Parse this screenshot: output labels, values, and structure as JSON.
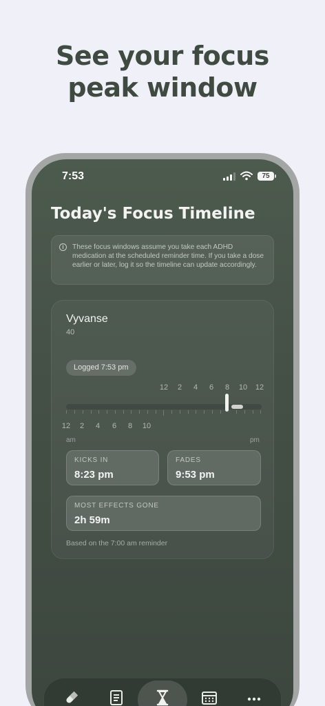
{
  "promo": {
    "headline_line1": "See your focus",
    "headline_line2": "peak window"
  },
  "status_bar": {
    "time": "7:53",
    "battery": "75"
  },
  "screen": {
    "title": "Today's Focus Timeline",
    "info_note": "These focus windows assume you take each ADHD medication at the scheduled reminder time. If you take a dose earlier or later, log it so the timeline can update accordingly.",
    "info_icon": "info-circle-icon"
  },
  "medication_card": {
    "name": "Vyvanse",
    "dose": "40",
    "logged_chip": "Logged 7:53 pm",
    "upper_ticks": [
      "12",
      "2",
      "4",
      "6",
      "8",
      "10",
      "12"
    ],
    "lower_ticks": [
      "12",
      "2",
      "4",
      "6",
      "8",
      "10"
    ],
    "am_label": "am",
    "pm_label": "pm",
    "kicks_in_label": "KICKS IN",
    "kicks_in_value": "8:23 pm",
    "fades_label": "FADES",
    "fades_value": "9:53 pm",
    "effects_gone_label": "MOST EFFECTS GONE",
    "effects_gone_value": "2h 59m",
    "footnote": "Based on the 7:00 am reminder"
  },
  "tab_bar": {
    "tabs": [
      {
        "icon": "pill-icon",
        "active": false
      },
      {
        "icon": "notes-icon",
        "active": false
      },
      {
        "icon": "hourglass-icon",
        "active": true
      },
      {
        "icon": "calendar-icon",
        "active": false
      },
      {
        "icon": "more-icon",
        "active": false
      }
    ]
  },
  "colors": {
    "page_background": "#f0f0f8",
    "headline": "#3f4a41",
    "screen_background": "#445046",
    "accent_light": "#f1f1ee"
  }
}
